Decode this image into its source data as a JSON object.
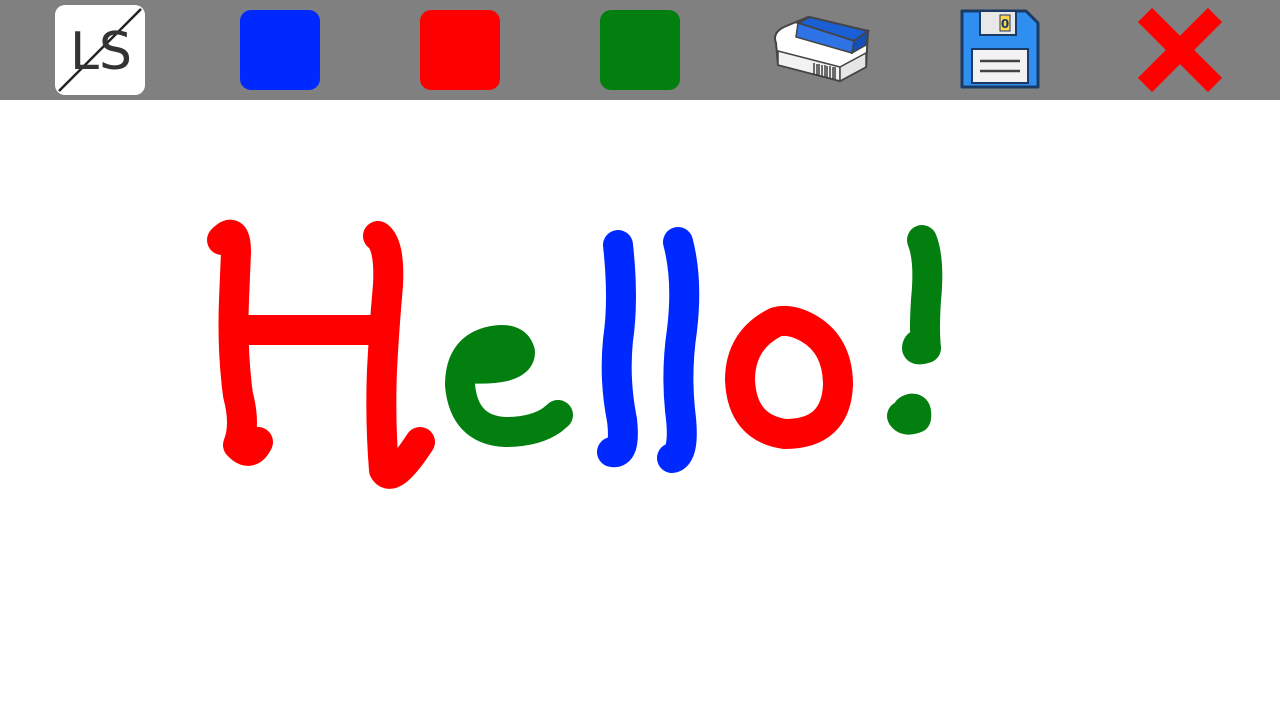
{
  "app": {
    "logo_text": "LS"
  },
  "toolbar": {
    "logo_icon": "ls-logo-icon",
    "colors": [
      {
        "name": "blue",
        "hex": "#0029ff"
      },
      {
        "name": "red",
        "hex": "#ff0000"
      },
      {
        "name": "green",
        "hex": "#037f10"
      }
    ],
    "eraser_icon": "eraser-icon",
    "save_icon": "floppy-disk-icon",
    "save_icon_label": "0",
    "close_icon": "close-x-icon",
    "close_color": "#ff0000"
  },
  "canvas": {
    "background": "#ffffff",
    "drawing_text": "Hello!",
    "stroke_colors": {
      "H": "#ff0000",
      "e": "#037f10",
      "l1": "#0029ff",
      "l2": "#0029ff",
      "o": "#ff0000",
      "exclamation": "#037f10"
    }
  }
}
